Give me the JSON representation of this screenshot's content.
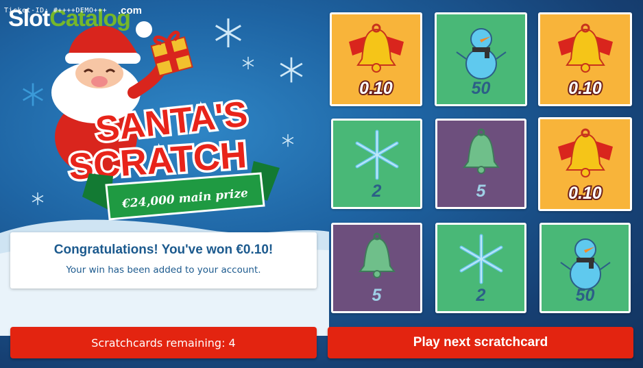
{
  "ticket_id": "Ticket-ID: #++++DEMO+++",
  "brand": {
    "part1": "Slot",
    "part2": "Catalog",
    "part3": ".com"
  },
  "logo": {
    "line1": "SANTA'S",
    "line2": "SCRATCH",
    "banner": "€24,000 main prize"
  },
  "message": {
    "title": "Congratulations! You've won €0.10!",
    "subtitle": "Your win has been added to your account."
  },
  "buttons": {
    "remaining": "Scratchcards remaining: 4",
    "play_next": "Play next scratchcard"
  },
  "colors": {
    "gold": "#f8b43a",
    "green": "#49b877",
    "purple": "#6d4f7d",
    "button_red": "#e32410"
  },
  "grid": [
    {
      "symbol": "gold-bell-icon",
      "value": "0.10",
      "style": "gold"
    },
    {
      "symbol": "snowman-icon",
      "value": "50",
      "style": "green"
    },
    {
      "symbol": "gold-bell-icon",
      "value": "0.10",
      "style": "gold"
    },
    {
      "symbol": "snowflake-icon",
      "value": "2",
      "style": "green"
    },
    {
      "symbol": "green-bell-icon",
      "value": "5",
      "style": "purple"
    },
    {
      "symbol": "gold-bell-icon",
      "value": "0.10",
      "style": "gold"
    },
    {
      "symbol": "green-bell-icon",
      "value": "5",
      "style": "purple"
    },
    {
      "symbol": "snowflake-icon",
      "value": "2",
      "style": "green"
    },
    {
      "symbol": "snowman-icon",
      "value": "50",
      "style": "green"
    }
  ]
}
